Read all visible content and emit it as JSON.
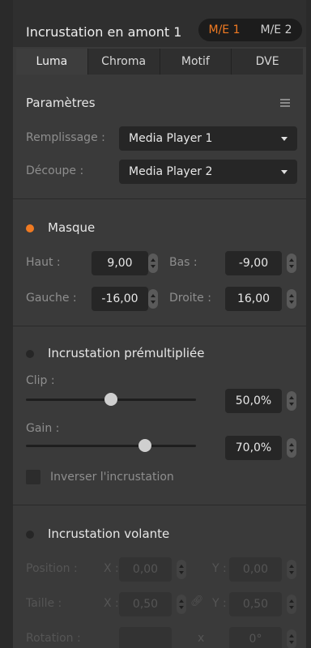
{
  "header": {
    "title": "Incrustation en amont 1",
    "me_buttons": [
      "M/E 1",
      "M/E 2"
    ]
  },
  "tabs": [
    "Luma",
    "Chroma",
    "Motif",
    "DVE"
  ],
  "params": {
    "title": "Paramètres",
    "fill_label": "Remplissage :",
    "fill_value": "Media Player 1",
    "key_label": "Découpe :",
    "key_value": "Media Player 2"
  },
  "mask": {
    "title": "Masque",
    "top_label": "Haut :",
    "top_value": "9,00",
    "bottom_label": "Bas :",
    "bottom_value": "-9,00",
    "left_label": "Gauche :",
    "left_value": "-16,00",
    "right_label": "Droite :",
    "right_value": "16,00"
  },
  "premult": {
    "title": "Incrustation prémultipliée",
    "clip_label": "Clip :",
    "clip_value": "50,0%",
    "clip_level": 50,
    "gain_label": "Gain :",
    "gain_value": "70,0%",
    "gain_level": 70,
    "invert_label": "Inverser l'incrustation"
  },
  "fly": {
    "title": "Incrustation volante",
    "position_label": "Position :",
    "x_label": "X :",
    "y_label": "Y :",
    "pos_x": "0,00",
    "pos_y": "0,00",
    "size_label": "Taille :",
    "size_x": "0,50",
    "size_y": "0,50",
    "rotation_label": "Rotation :",
    "rotation_x_label": "x",
    "rotation_value": "0°"
  },
  "colors": {
    "accent": "#f07a22",
    "panel_bg": "#3a3a3a",
    "field_bg": "#262626"
  }
}
